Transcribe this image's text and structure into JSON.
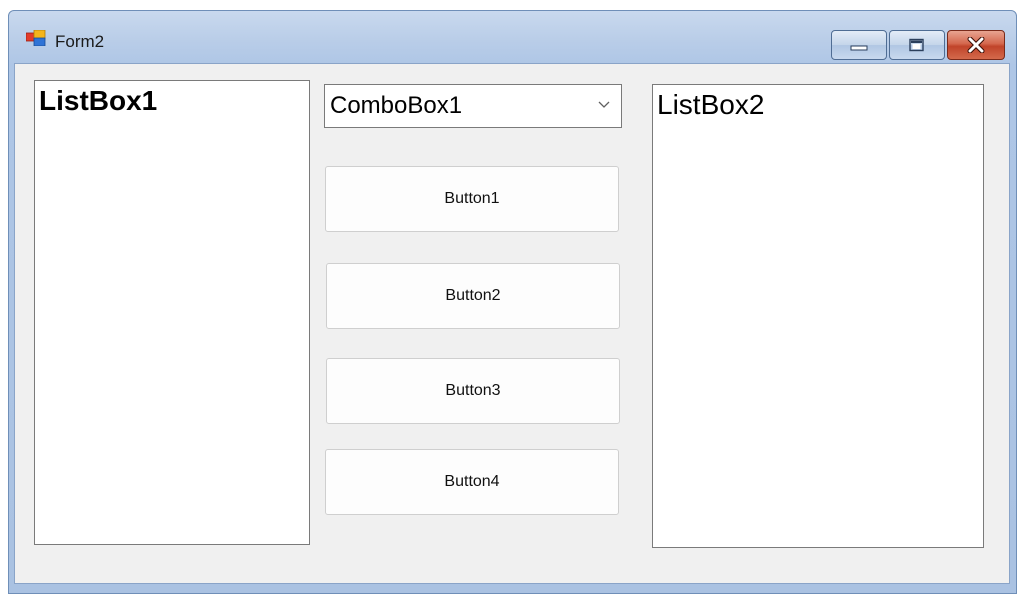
{
  "window": {
    "title": "Form2"
  },
  "listbox1": {
    "items": [
      "ListBox1"
    ]
  },
  "listbox2": {
    "items": [
      "ListBox2"
    ]
  },
  "combobox1": {
    "value": "ComboBox1"
  },
  "buttons": [
    {
      "label": "Button1"
    },
    {
      "label": "Button2"
    },
    {
      "label": "Button3"
    },
    {
      "label": "Button4"
    }
  ],
  "icons": {
    "app": "winforms-app-icon",
    "minimize": "minimize-icon",
    "maximize": "maximize-icon",
    "close": "close-icon",
    "dropdown": "chevron-down-icon"
  },
  "colors": {
    "titlebar": "#b9cde8",
    "client_background": "#f0f0f0",
    "close_button": "#c8553a"
  }
}
